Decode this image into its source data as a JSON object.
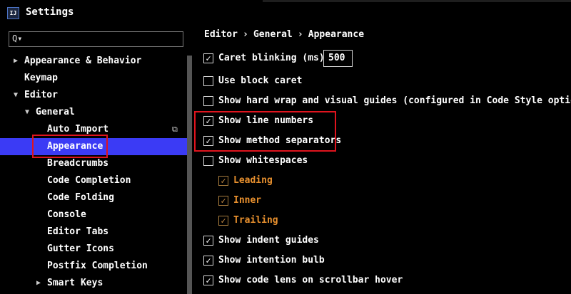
{
  "window": {
    "app_icon": "IJ",
    "title": "Settings"
  },
  "search": {
    "glyph": "Q▾",
    "value": ""
  },
  "tree": [
    {
      "label": "Appearance & Behavior",
      "arrow": "▶"
    },
    {
      "label": "Keymap",
      "arrow": ""
    },
    {
      "label": "Editor",
      "arrow": "▼"
    },
    {
      "label": "General",
      "arrow": "▼"
    },
    {
      "label": "Auto Import",
      "arrow": ""
    },
    {
      "label": "Appearance",
      "arrow": ""
    },
    {
      "label": "Breadcrumbs",
      "arrow": ""
    },
    {
      "label": "Code Completion",
      "arrow": ""
    },
    {
      "label": "Code Folding",
      "arrow": ""
    },
    {
      "label": "Console",
      "arrow": ""
    },
    {
      "label": "Editor Tabs",
      "arrow": ""
    },
    {
      "label": "Gutter Icons",
      "arrow": ""
    },
    {
      "label": "Postfix Completion",
      "arrow": ""
    },
    {
      "label": "Smart Keys",
      "arrow": "▶"
    }
  ],
  "selected_item": "Appearance",
  "copy_icon_glyph": "⧉",
  "breadcrumb": {
    "parts": [
      "Editor",
      "General",
      "Appearance"
    ],
    "separator": "›"
  },
  "options": [
    {
      "label": "Caret blinking (ms):",
      "checked": true,
      "enabled": true,
      "value": "500"
    },
    {
      "label": "Use block caret",
      "checked": false,
      "enabled": true
    },
    {
      "label": "Show hard wrap and visual guides (configured in Code Style options)",
      "checked": false,
      "enabled": true
    },
    {
      "label": "Show line numbers",
      "checked": true,
      "enabled": true
    },
    {
      "label": "Show method separators",
      "checked": true,
      "enabled": true
    },
    {
      "label": "Show whitespaces",
      "checked": false,
      "enabled": true
    },
    {
      "label": "Leading",
      "checked": true,
      "enabled": false
    },
    {
      "label": "Inner",
      "checked": true,
      "enabled": false
    },
    {
      "label": "Trailing",
      "checked": true,
      "enabled": false
    },
    {
      "label": "Show indent guides",
      "checked": true,
      "enabled": true
    },
    {
      "label": "Show intention bulb",
      "checked": true,
      "enabled": true
    },
    {
      "label": "Show code lens on scrollbar hover",
      "checked": true,
      "enabled": true
    }
  ],
  "check_glyph": "✓",
  "colors": {
    "selection": "#3b3bf5",
    "highlight": "#e0141e",
    "disabled_text": "#e8902e"
  }
}
